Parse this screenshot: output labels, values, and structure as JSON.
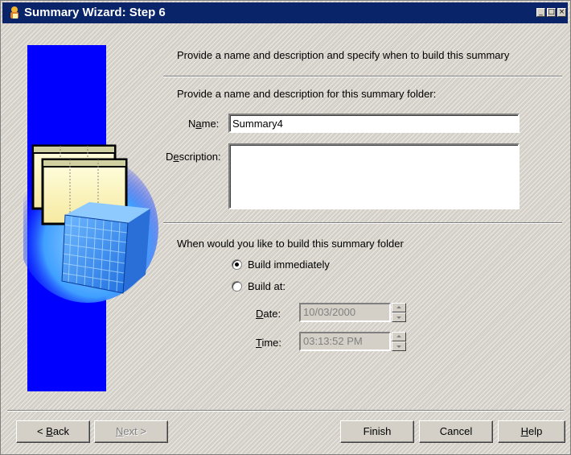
{
  "window": {
    "title": "Summary Wizard: Step 6",
    "controls": {
      "minimize": "_",
      "maximize": "□",
      "close": "×"
    }
  },
  "heading": "Provide a name and description and specify when to build this summary",
  "name_section": {
    "subheading": "Provide a name and description for this summary folder:",
    "name_label": {
      "pre": "N",
      "accel": "a",
      "post": "me:"
    },
    "name_value": "Summary4",
    "description_label": {
      "pre": "D",
      "accel": "e",
      "post": "scription:"
    },
    "description_value": ""
  },
  "build_section": {
    "question": "When would you like to build this summary folder",
    "options": [
      {
        "label": "Build immediately",
        "selected": true
      },
      {
        "label": "Build at:",
        "selected": false
      }
    ],
    "date_label": {
      "accel": "D",
      "post": "ate:"
    },
    "date_value": "10/03/2000",
    "time_label": {
      "accel": "T",
      "post": "ime:"
    },
    "time_value": "03:13:52 PM"
  },
  "buttons": {
    "back": {
      "pre": "< ",
      "accel": "B",
      "post": "ack"
    },
    "next": {
      "accel": "N",
      "post": "ext >"
    },
    "finish": "Finish",
    "cancel": "Cancel",
    "help": {
      "accel": "H",
      "post": "elp"
    }
  },
  "colors": {
    "title_bar": "#0a246a",
    "side_panel": "#0000ff",
    "dialog_face": "#d4d0c8"
  },
  "icons": [
    "wizard-icon",
    "summary-folder-illustration"
  ]
}
